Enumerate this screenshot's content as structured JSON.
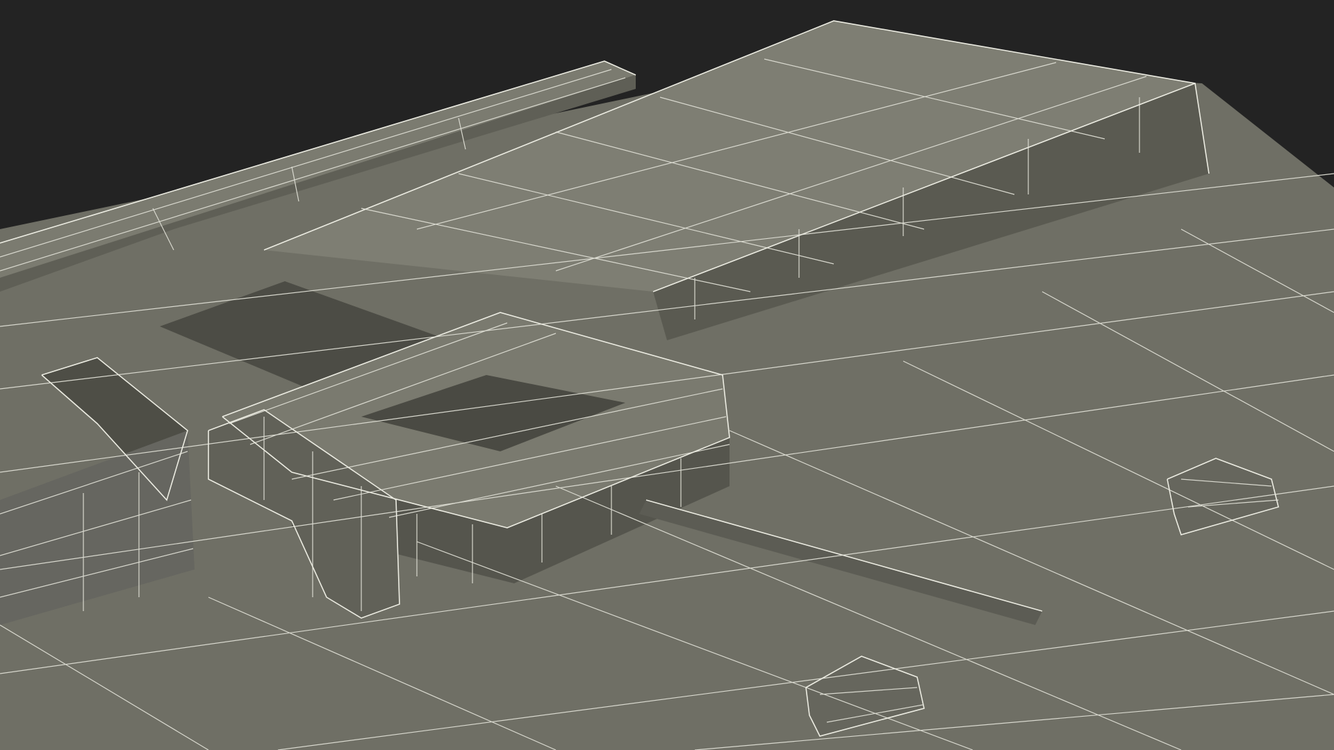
{
  "scene": {
    "subject": "wireframe-plastic-tray-with-buckle-clip",
    "colors": {
      "background": "#232323",
      "surface_light": "#7b7b70",
      "surface_mid": "#6f6f65",
      "surface_dark": "#5a5a51",
      "shadow": "#4a4a43",
      "wire": "#d9d9cf"
    }
  }
}
